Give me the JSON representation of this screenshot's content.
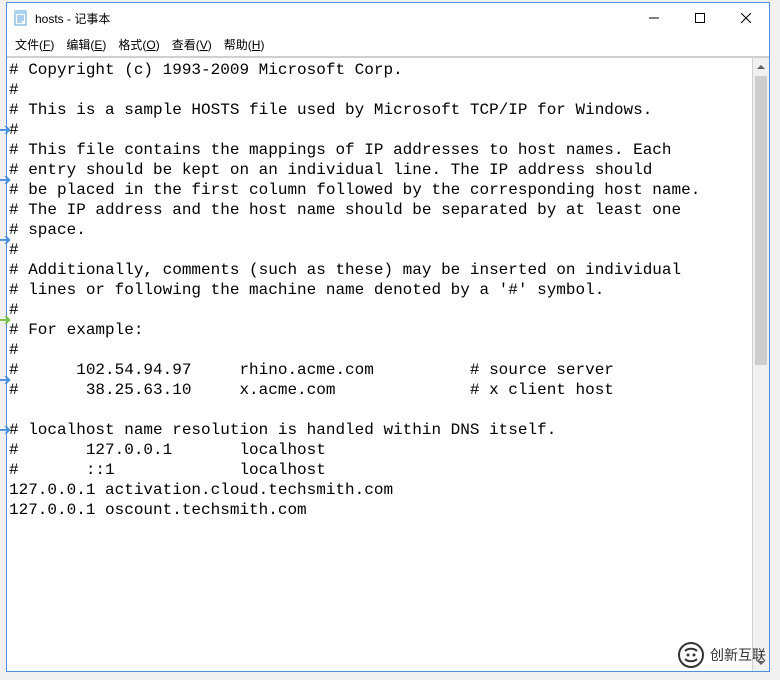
{
  "title": "hosts - 记事本",
  "menu": {
    "file": {
      "label": "文件",
      "key": "F"
    },
    "edit": {
      "label": "编辑",
      "key": "E"
    },
    "format": {
      "label": "格式",
      "key": "O"
    },
    "view": {
      "label": "查看",
      "key": "V"
    },
    "help": {
      "label": "帮助",
      "key": "H"
    }
  },
  "content": "# Copyright (c) 1993-2009 Microsoft Corp.\n#\n# This is a sample HOSTS file used by Microsoft TCP/IP for Windows.\n#\n# This file contains the mappings of IP addresses to host names. Each\n# entry should be kept on an individual line. The IP address should\n# be placed in the first column followed by the corresponding host name.\n# The IP address and the host name should be separated by at least one\n# space.\n#\n# Additionally, comments (such as these) may be inserted on individual\n# lines or following the machine name denoted by a '#' symbol.\n#\n# For example:\n#\n#      102.54.94.97     rhino.acme.com          # source server\n#       38.25.63.10     x.acme.com              # x client host\n\n# localhost name resolution is handled within DNS itself.\n#       127.0.0.1       localhost\n#       ::1             localhost\n127.0.0.1 activation.cloud.techsmith.com\n127.0.0.1 oscount.techsmith.com",
  "watermark": "创新互联"
}
